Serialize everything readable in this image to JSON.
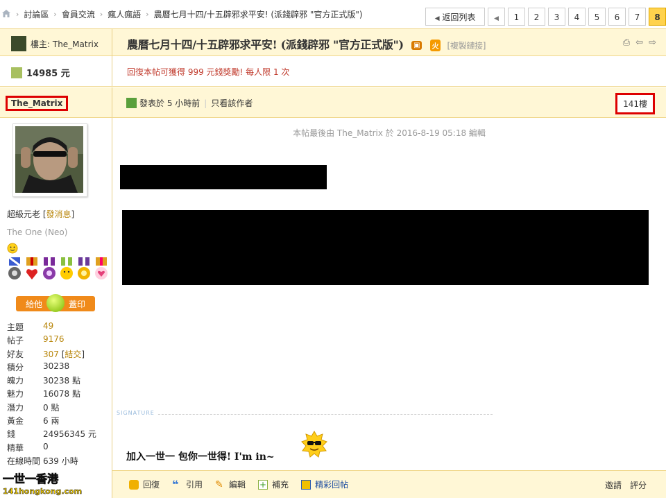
{
  "breadcrumb": [
    "討論區",
    "會員交流",
    "瘋人瘋語",
    "農曆七月十四/十五辟邪求平安! (派錢辟邪 \"官方正式版\")"
  ],
  "pager": {
    "back": "返回列表",
    "pages": [
      "1",
      "2",
      "3",
      "4",
      "5",
      "6",
      "7"
    ],
    "current": "8"
  },
  "thread": {
    "owner_label": "樓主: The_Matrix",
    "title": "農曆七月十四/十五辟邪求平安! (派錢辟邪 \"官方正式版\")",
    "hot_badge": "火",
    "copy_link": "[複製鏈接]"
  },
  "money": "14985 元",
  "reward_notice": "回復本帖可獲得 999 元錢獎勵! 每人限 1 次",
  "post": {
    "author": "The_Matrix",
    "posted": "發表於 5 小時前",
    "author_only": "只看該作者",
    "floor": "141樓",
    "edited": "本帖最後由 The_Matrix 於 2016-8-19 05:18 編輯",
    "signature_label": "SIGNATURE",
    "signature_text": "加入一世一 包你一世得!  I'm in~"
  },
  "profile": {
    "rank": "超級元老",
    "pm_link": "發消息",
    "custom_title": "The One (Neo)",
    "give_left": "給他",
    "give_right": "蓋印",
    "stats": [
      {
        "k": "主題",
        "v": "49"
      },
      {
        "k": "帖子",
        "v": "9176"
      },
      {
        "k": "好友",
        "v": "307"
      },
      {
        "k": "積分",
        "v": "30238"
      },
      {
        "k": "魄力",
        "v": "30238 點"
      },
      {
        "k": "魅力",
        "v": "16078 點"
      },
      {
        "k": "潛力",
        "v": "0 點"
      },
      {
        "k": "黃金",
        "v": "6 兩"
      },
      {
        "k": "錢",
        "v": "24956345 元"
      },
      {
        "k": "精華",
        "v": "0"
      },
      {
        "k": "在線時間",
        "v": "639 小時"
      }
    ],
    "make_friend": "結交"
  },
  "actions": [
    "回復",
    "引用",
    "編輯",
    "補充",
    "精彩回帖"
  ],
  "foot_right": [
    "邀請",
    "評分"
  ],
  "site_logo": "一世一香港 141hongkong.com"
}
